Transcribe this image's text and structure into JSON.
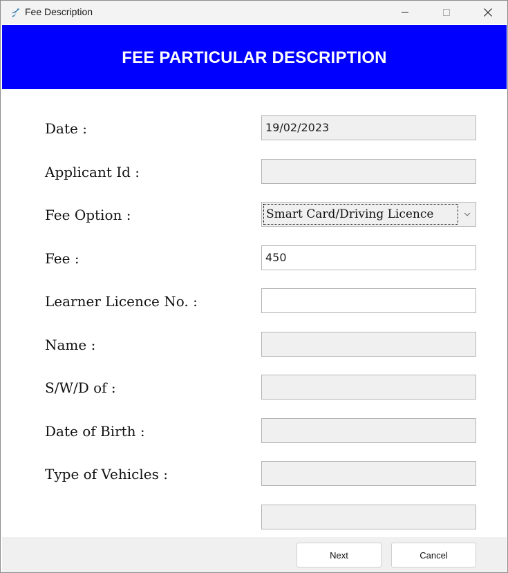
{
  "window": {
    "title": "Fee Description",
    "minimize_icon": "minimize-icon",
    "maximize_icon": "maximize-icon",
    "close_icon": "close-icon"
  },
  "header": {
    "title": "FEE PARTICULAR DESCRIPTION",
    "background": "#0000ff"
  },
  "form": {
    "date": {
      "label": "Date :",
      "value": "19/02/2023"
    },
    "applicant_id": {
      "label": "Applicant Id :",
      "value": ""
    },
    "fee_option": {
      "label": "Fee Option :",
      "value": "Smart Card/Driving Licence"
    },
    "fee": {
      "label": "Fee :",
      "value": "450"
    },
    "learner_licence_no": {
      "label": "Learner Licence No. :",
      "value": ""
    },
    "name": {
      "label": "Name :",
      "value": ""
    },
    "swd_of": {
      "label": "S/W/D of :",
      "value": ""
    },
    "date_of_birth": {
      "label": "Date of Birth :",
      "value": ""
    },
    "type_of_vehicles": {
      "label": "Type of Vehicles :",
      "value": ""
    },
    "extra": {
      "value": ""
    }
  },
  "footer": {
    "next_label": "Next",
    "cancel_label": "Cancel"
  }
}
